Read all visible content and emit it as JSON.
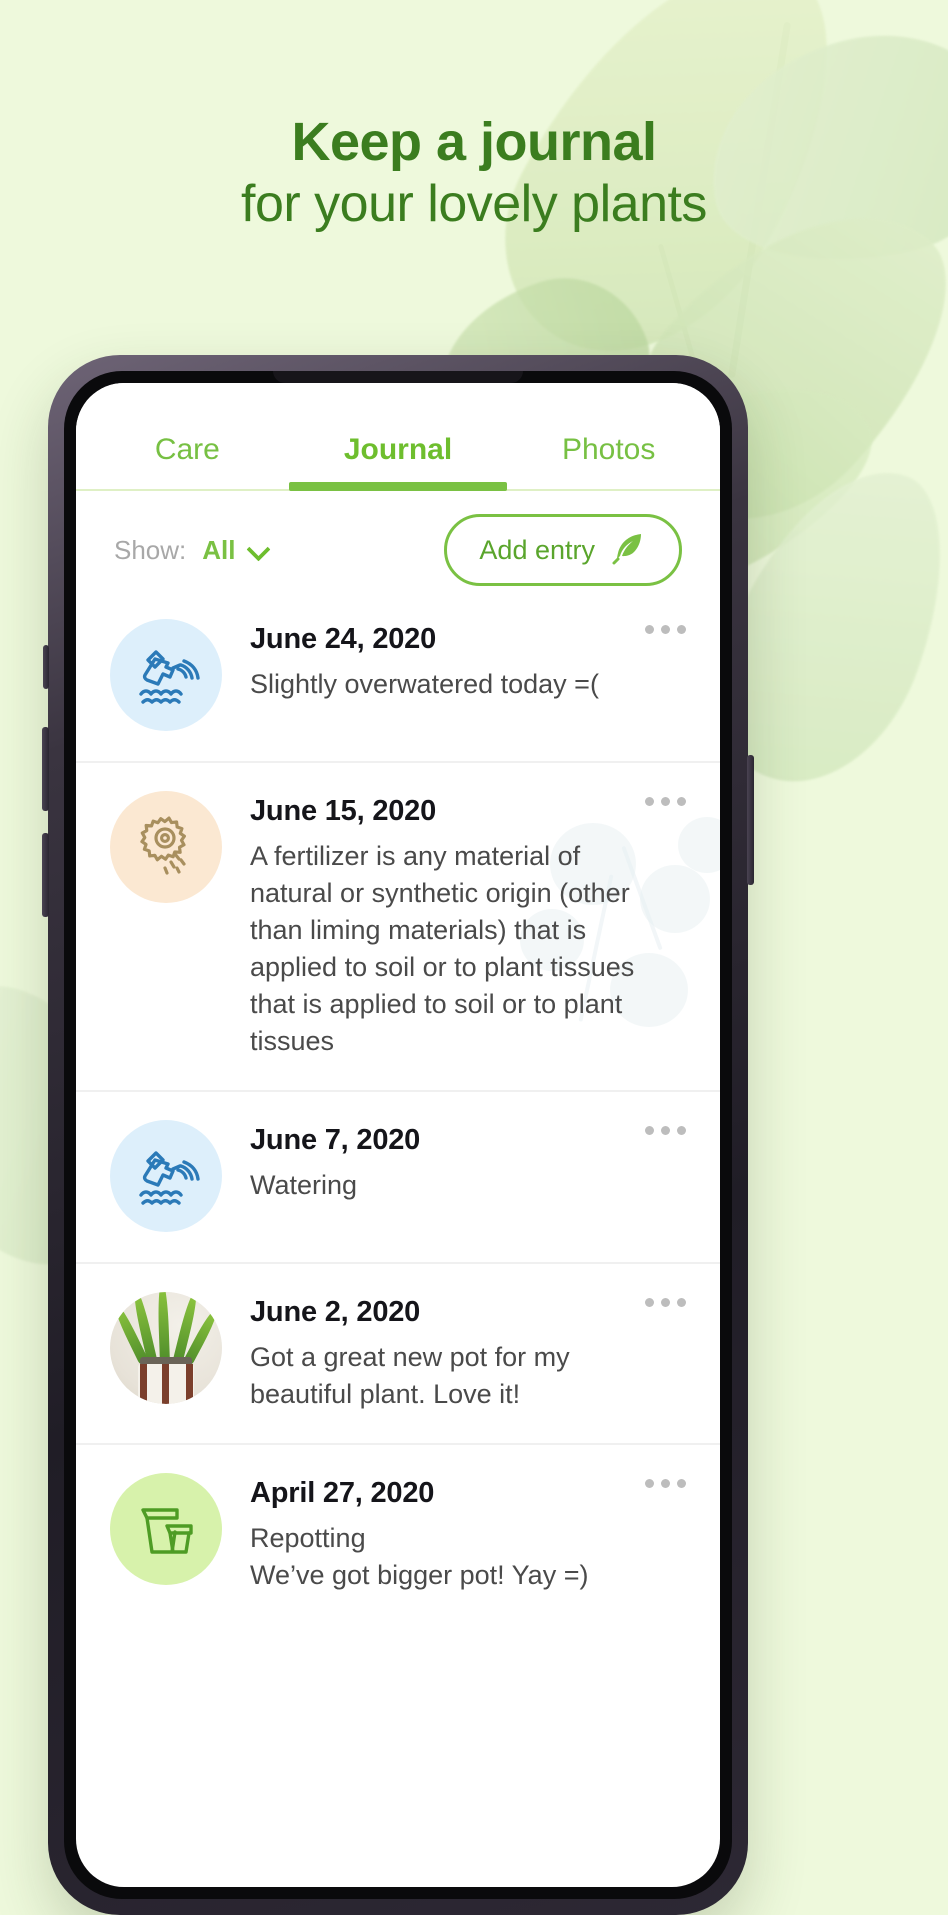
{
  "promo": {
    "headline_line1": "Keep a journal",
    "headline_line2": "for your lovely plants",
    "brand_green": "#3b7d1f",
    "background": "#eef9dc"
  },
  "app": {
    "accent_green": "#7ac143",
    "tabs": [
      {
        "label": "Care",
        "active": false
      },
      {
        "label": "Journal",
        "active": true
      },
      {
        "label": "Photos",
        "active": false
      }
    ],
    "filter": {
      "show_label": "Show:",
      "show_value": "All",
      "chevron_icon": "chevron-down-icon"
    },
    "add_entry": {
      "label": "Add entry",
      "icon": "feather-quill-icon"
    },
    "entries": [
      {
        "date": "June 24, 2020",
        "text": "Slightly overwatered today =(",
        "icon": "watering-can-icon",
        "icon_style": "water",
        "menu_icon": "more-options-icon"
      },
      {
        "date": "June 15, 2020",
        "text": "A fertilizer is any material of natural or synthetic origin (other than liming materials) that is applied to soil or to plant tissues that is applied to soil or to plant tissues",
        "icon": "fertilizer-packet-icon",
        "icon_style": "fert",
        "menu_icon": "more-options-icon"
      },
      {
        "date": "June 7, 2020",
        "text": "Watering",
        "icon": "watering-can-icon",
        "icon_style": "water",
        "menu_icon": "more-options-icon"
      },
      {
        "date": "June 2, 2020",
        "text": "Got a great new pot for my beautiful plant. Love it!",
        "icon": "plant-photo-thumbnail",
        "icon_style": "photo",
        "menu_icon": "more-options-icon"
      },
      {
        "date": "April 27, 2020",
        "text": "Repotting\nWe’ve got bigger pot! Yay =)",
        "icon": "repotting-pots-icon",
        "icon_style": "repot",
        "menu_icon": "more-options-icon"
      }
    ]
  }
}
